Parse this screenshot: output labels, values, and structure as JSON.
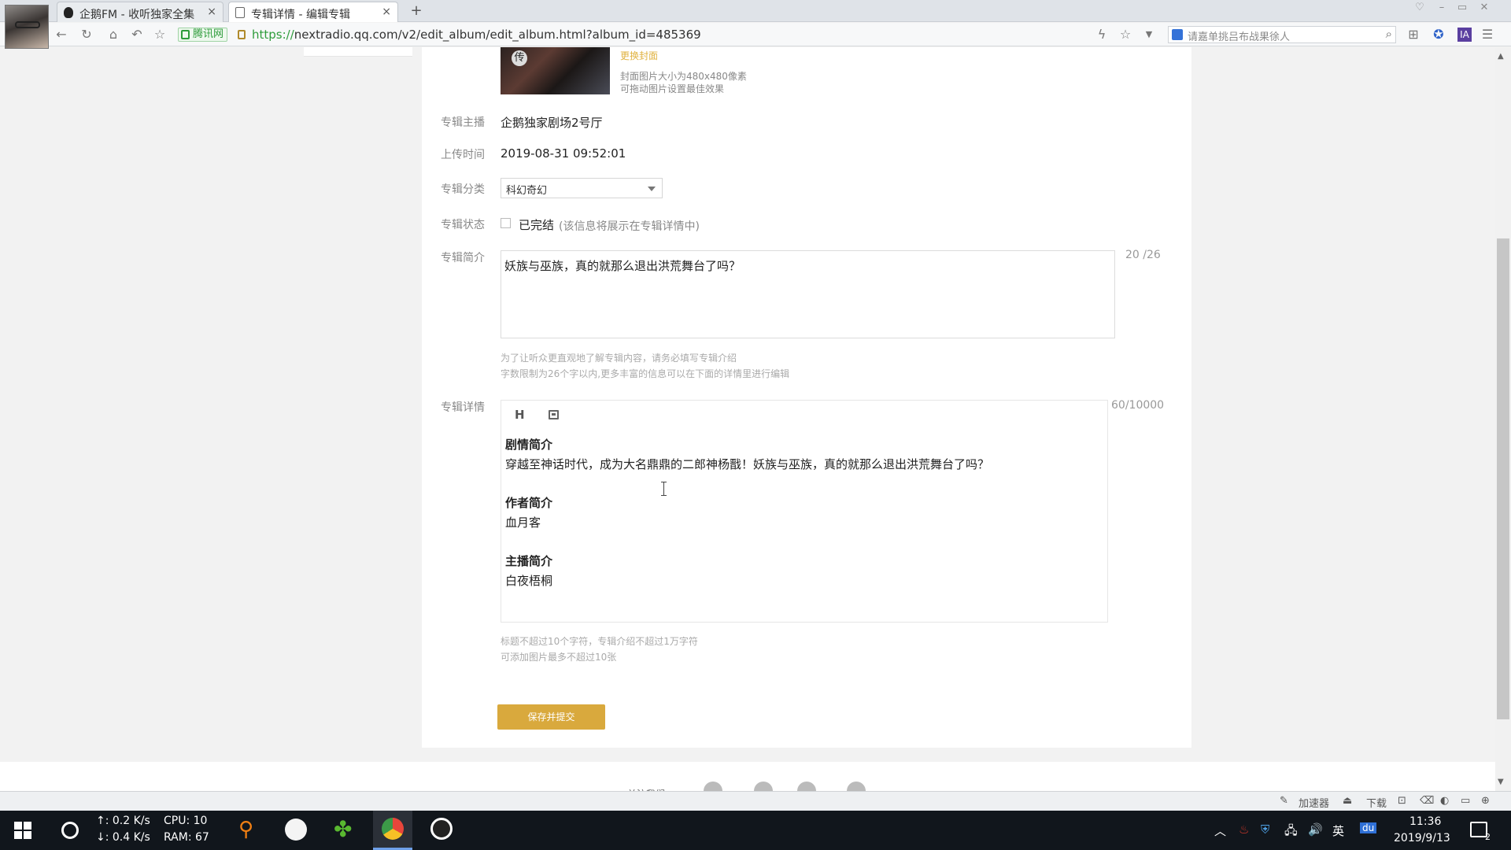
{
  "browser": {
    "tabs": [
      {
        "label": "企鹅FM - 收听独家全集"
      },
      {
        "label": "专辑详情 - 编辑专辑"
      }
    ],
    "site_badge": "腾讯网",
    "url_scheme": "https://",
    "url_rest": "nextradio.qq.com/v2/edit_album/edit_album.html?album_id=485369",
    "search_placeholder": "请嘉单挑吕布战果徐人"
  },
  "form": {
    "cover": {
      "badge": "传",
      "change_label": "更换封面",
      "hint_size": "封面图片大小为480x480像素",
      "hint_drag": "可拖动图片设置最佳效果"
    },
    "host": {
      "label": "专辑主播",
      "value": "企鹅独家剧场2号厅"
    },
    "upload_time": {
      "label": "上传时间",
      "value": "2019-08-31 09:52:01"
    },
    "category": {
      "label": "专辑分类",
      "value": "科幻奇幻"
    },
    "status": {
      "label": "专辑状态",
      "option": "已完结",
      "note": "(该信息将展示在专辑详情中)"
    },
    "intro": {
      "label": "专辑简介",
      "value": "妖族与巫族，真的就那么退出洪荒舞台了吗？",
      "count": "20 /26",
      "hint1": "为了让听众更直观地了解专辑内容，请务必填写专辑介绍",
      "hint2": "字数限制为26个字以内,更多丰富的信息可以在下面的详情里进行编辑"
    },
    "detail": {
      "label": "专辑详情",
      "heading_tool": "H",
      "count": "60/10000",
      "sections": [
        {
          "heading": "剧情简介",
          "body": "穿越至神话时代，成为大名鼎鼎的二郎神杨戬！妖族与巫族，真的就那么退出洪荒舞台了吗？"
        },
        {
          "heading": "作者简介",
          "body": "血月客"
        },
        {
          "heading": "主播简介",
          "body": "白夜梧桐"
        }
      ],
      "hint1": "标题不超过10个字符，专辑介绍不超过1万字符",
      "hint2": "可添加图片最多不超过10张"
    },
    "submit_label": "保存并提交"
  },
  "footer": {
    "follow_label": "关注我们:"
  },
  "statusbar": {
    "accelerator": "加速器",
    "download": "下载"
  },
  "taskbar": {
    "net_up": "↑: 0.2 K/s",
    "net_down": "↓: 0.4 K/s",
    "cpu": "CPU:  10",
    "ram": "RAM: 67",
    "ime": "英",
    "time": "11:36",
    "date": "2019/9/13",
    "notif_count": "2"
  },
  "colors": {
    "accent": "#d9a93d",
    "link_gold": "#e0b23f",
    "taskbar": "#11161c"
  }
}
